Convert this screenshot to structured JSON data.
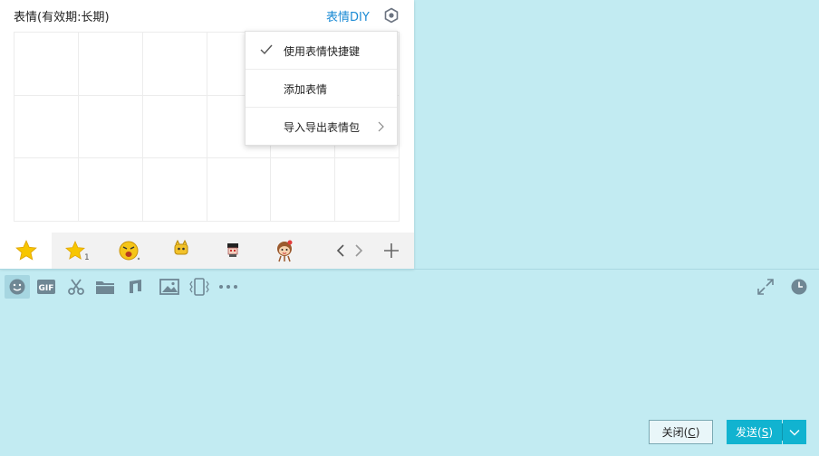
{
  "emoji_panel": {
    "title": "表情(有效期:长期)",
    "diy_label": "表情DIY",
    "tabs": [
      {
        "icon": "star-icon",
        "active": true
      },
      {
        "icon": "star-badge-icon",
        "active": false
      },
      {
        "icon": "angry-face-emoji-icon",
        "active": false
      },
      {
        "icon": "yellow-character-emoji-icon",
        "active": false
      },
      {
        "icon": "small-character-emoji-icon",
        "active": false
      },
      {
        "icon": "monkey-girl-emoji-icon",
        "active": false
      }
    ]
  },
  "menu": {
    "items": [
      {
        "label": "使用表情快捷键",
        "checked": true
      },
      {
        "label": "添加表情",
        "checked": false
      },
      {
        "label": "导入导出表情包",
        "has_submenu": true
      }
    ]
  },
  "toolbar": {
    "tools": [
      "emoji-icon",
      "gif-icon",
      "scissors-icon",
      "folder-icon",
      "music-note-icon",
      "image-icon",
      "shake-icon",
      "more-icon"
    ],
    "right_tools": [
      "expand-icon",
      "history-clock-icon"
    ]
  },
  "buttons": {
    "close_prefix": "关闭(",
    "close_key": "C",
    "close_suffix": ")",
    "send_prefix": "发送(",
    "send_key": "S",
    "send_suffix": ")"
  },
  "colors": {
    "chat_background": "#c2ebf2",
    "accent": "#11b3d0",
    "link": "#1a8ad4"
  }
}
